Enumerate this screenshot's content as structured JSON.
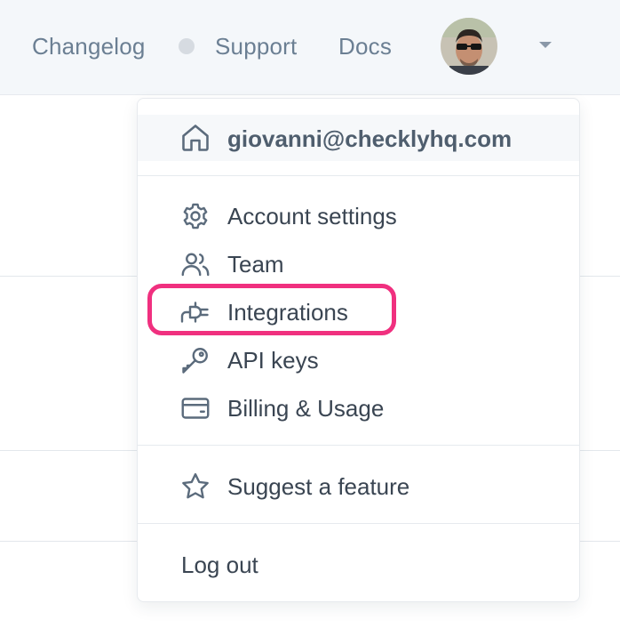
{
  "topbar": {
    "links": [
      {
        "label": "Changelog"
      },
      {
        "label": "Support"
      },
      {
        "label": "Docs"
      }
    ],
    "avatar_icon": "user-avatar",
    "caret_icon": "caret-down-icon"
  },
  "menu": {
    "email": "giovanni@checklyhq.com",
    "email_icon": "home-icon",
    "items": [
      {
        "label": "Account settings",
        "icon": "gear-icon"
      },
      {
        "label": "Team",
        "icon": "users-icon"
      },
      {
        "label": "Integrations",
        "icon": "plug-icon",
        "highlighted": true
      },
      {
        "label": "API keys",
        "icon": "key-icon"
      },
      {
        "label": "Billing & Usage",
        "icon": "credit-card-icon"
      }
    ],
    "suggest": {
      "label": "Suggest a feature",
      "icon": "star-icon"
    },
    "logout": {
      "label": "Log out"
    }
  },
  "colors": {
    "highlight": "#f0307f",
    "icon_stroke": "#5b6b7c"
  }
}
